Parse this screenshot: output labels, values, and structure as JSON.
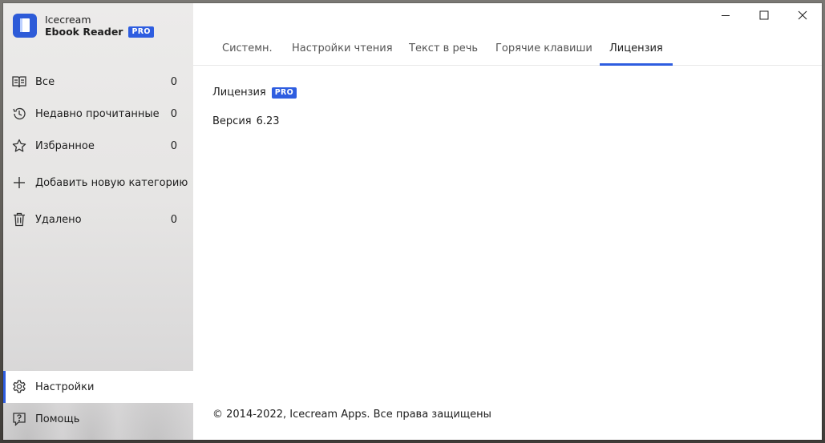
{
  "app": {
    "name_line1": "Icecream",
    "name_line2": "Ebook Reader",
    "badge": "PRO",
    "accent_color": "#2e5de0"
  },
  "sidebar": {
    "items": [
      {
        "label": "Все",
        "count": "0",
        "icon": "library-book-icon"
      },
      {
        "label": "Недавно прочитанные",
        "count": "0",
        "icon": "history-icon"
      },
      {
        "label": "Избранное",
        "count": "0",
        "icon": "star-icon"
      },
      {
        "label": "Добавить новую категорию",
        "count": "",
        "icon": "plus-icon"
      },
      {
        "label": "Удалено",
        "count": "0",
        "icon": "trash-icon"
      }
    ],
    "bottom": [
      {
        "label": "Настройки",
        "icon": "gear-icon",
        "active": true
      },
      {
        "label": "Помощь",
        "icon": "help-icon",
        "active": false
      }
    ]
  },
  "window_controls": {
    "minimize": "minimize-icon",
    "maximize": "maximize-icon",
    "close": "close-icon"
  },
  "tabs": [
    {
      "label": "Системн.",
      "active": false
    },
    {
      "label": "Настройки чтения",
      "active": false
    },
    {
      "label": "Текст в речь",
      "active": false
    },
    {
      "label": "Горячие клавиши",
      "active": false
    },
    {
      "label": "Лицензия",
      "active": true
    }
  ],
  "license": {
    "label": "Лицензия",
    "badge": "PRO",
    "version_label": "Версия",
    "version_value": "6.23"
  },
  "footer": {
    "copyright": "© 2014-2022, Icecream Apps. Все права защищены"
  }
}
